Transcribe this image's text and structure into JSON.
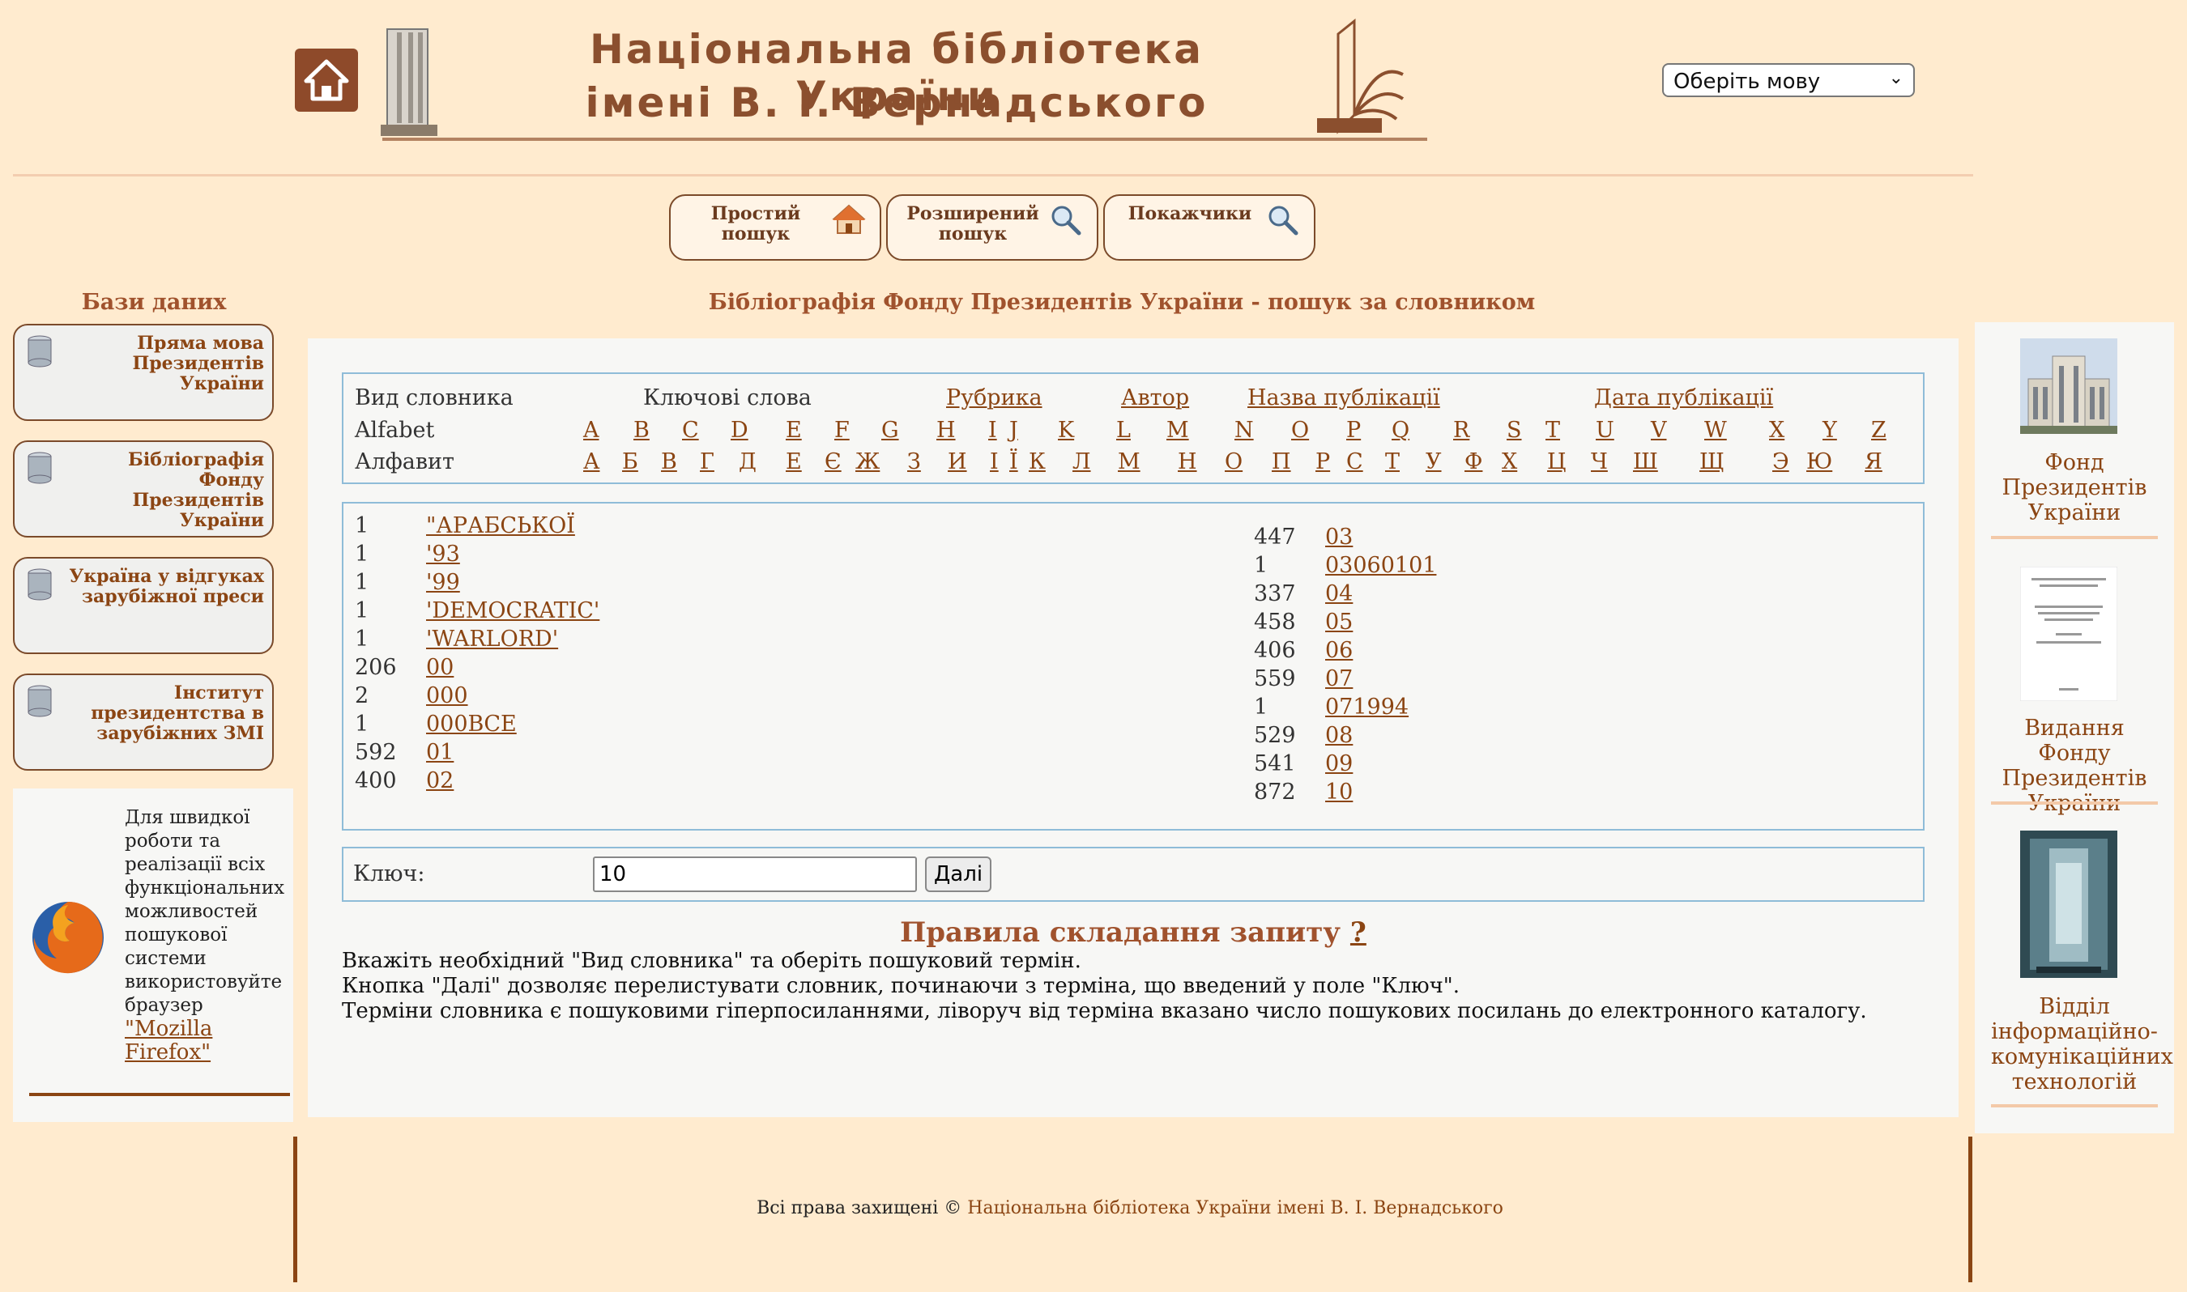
{
  "header": {
    "title_line1": "Національна бібліотека України",
    "title_line2": "імені В. І. Вернадського",
    "language_select": "Оберіть мову"
  },
  "search_tabs": [
    {
      "label": "Простий пошук",
      "icon": "house-icon"
    },
    {
      "label": "Розширений пошук",
      "icon": "magnifier-icon"
    },
    {
      "label": "Покажчики",
      "icon": "magnifier-icon"
    }
  ],
  "sidebar": {
    "title": "Бази даних",
    "items": [
      {
        "label": "Пряма мова Президентів України"
      },
      {
        "label": "Бібліографія Фонду Президентів України"
      },
      {
        "label": "Україна у відгуках зарубіжної преси"
      },
      {
        "label": "Інститут президентства в зарубіжних ЗМІ"
      }
    ],
    "firefox_text": "Для швидкої роботи та реалізації всіх функціональних можливостей пошукової системи використовуйте браузер",
    "firefox_link": "\"Mozilla Firefox\""
  },
  "main": {
    "page_title": "Бібліографія Фонду Президентів України - пошук за словником",
    "dict_header": {
      "label": "Вид словника",
      "keywords": "Ключові слова",
      "rubric": "Рубрика",
      "author": "Автор",
      "pub_title": "Назва публікації",
      "pub_date": "Дата публікації"
    },
    "latin_label": "Alfabet",
    "cyr_label": "Алфавит",
    "latin_letters": [
      "A",
      "B",
      "C",
      "D",
      "E",
      "F",
      "G",
      "H",
      "I",
      "J",
      "K",
      "L",
      "M",
      "N",
      "O",
      "P",
      "Q",
      "R",
      "S",
      "T",
      "U",
      "V",
      "W",
      "X",
      "Y",
      "Z"
    ],
    "cyr_letters": [
      "А",
      "Б",
      "В",
      "Г",
      "Д",
      "Е",
      "Є",
      "Ж",
      "З",
      "И",
      "І",
      "Ї",
      "К",
      "Л",
      "М",
      "Н",
      "О",
      "П",
      "Р",
      "С",
      "Т",
      "У",
      "Ф",
      "Х",
      "Ц",
      "Ч",
      "Ш",
      "Щ",
      "Э",
      "Ю",
      "Я"
    ],
    "terms_left": [
      {
        "count": "1",
        "term": "\"АРАБСЬКОЇ"
      },
      {
        "count": "1",
        "term": "'93"
      },
      {
        "count": "1",
        "term": "'99"
      },
      {
        "count": "1",
        "term": "'DEMOCRATIC'"
      },
      {
        "count": "1",
        "term": "'WARLORD'"
      },
      {
        "count": "206",
        "term": "00"
      },
      {
        "count": "2",
        "term": "000"
      },
      {
        "count": "1",
        "term": "000ВСЕ"
      },
      {
        "count": "592",
        "term": "01"
      },
      {
        "count": "400",
        "term": "02"
      }
    ],
    "terms_right": [
      {
        "count": "447",
        "term": "03"
      },
      {
        "count": "1",
        "term": "03060101"
      },
      {
        "count": "337",
        "term": "04"
      },
      {
        "count": "458",
        "term": "05"
      },
      {
        "count": "406",
        "term": "06"
      },
      {
        "count": "559",
        "term": "07"
      },
      {
        "count": "1",
        "term": "071994"
      },
      {
        "count": "529",
        "term": "08"
      },
      {
        "count": "541",
        "term": "09"
      },
      {
        "count": "872",
        "term": "10"
      }
    ],
    "key_label": "Ключ:",
    "key_value": "10",
    "next_button": "Далі",
    "rules_title": "Правила складання запиту",
    "rules_help": "?",
    "rules": [
      "Вкажіть необхідний \"Вид словника\" та оберіть пошуковий термін.",
      "Кнопка \"Далі\" дозволяє перелистувати словник, починаючи з терміна, що введений у поле \"Ключ\".",
      "Терміни словника є пошуковими гіперпосиланнями, ліворуч від терміна вказано число пошукових посилань до електронного каталогу."
    ]
  },
  "right_sidebar": [
    {
      "label": "Фонд Президентів України"
    },
    {
      "label": "Видання Фонду Президентів України"
    },
    {
      "label": "Відділ інформаційно-комунікаційних технологій"
    }
  ],
  "footer": {
    "copyright": "Всі права захищені ©",
    "link": "Національна бібліотека України імені В. І. Вернадського"
  }
}
